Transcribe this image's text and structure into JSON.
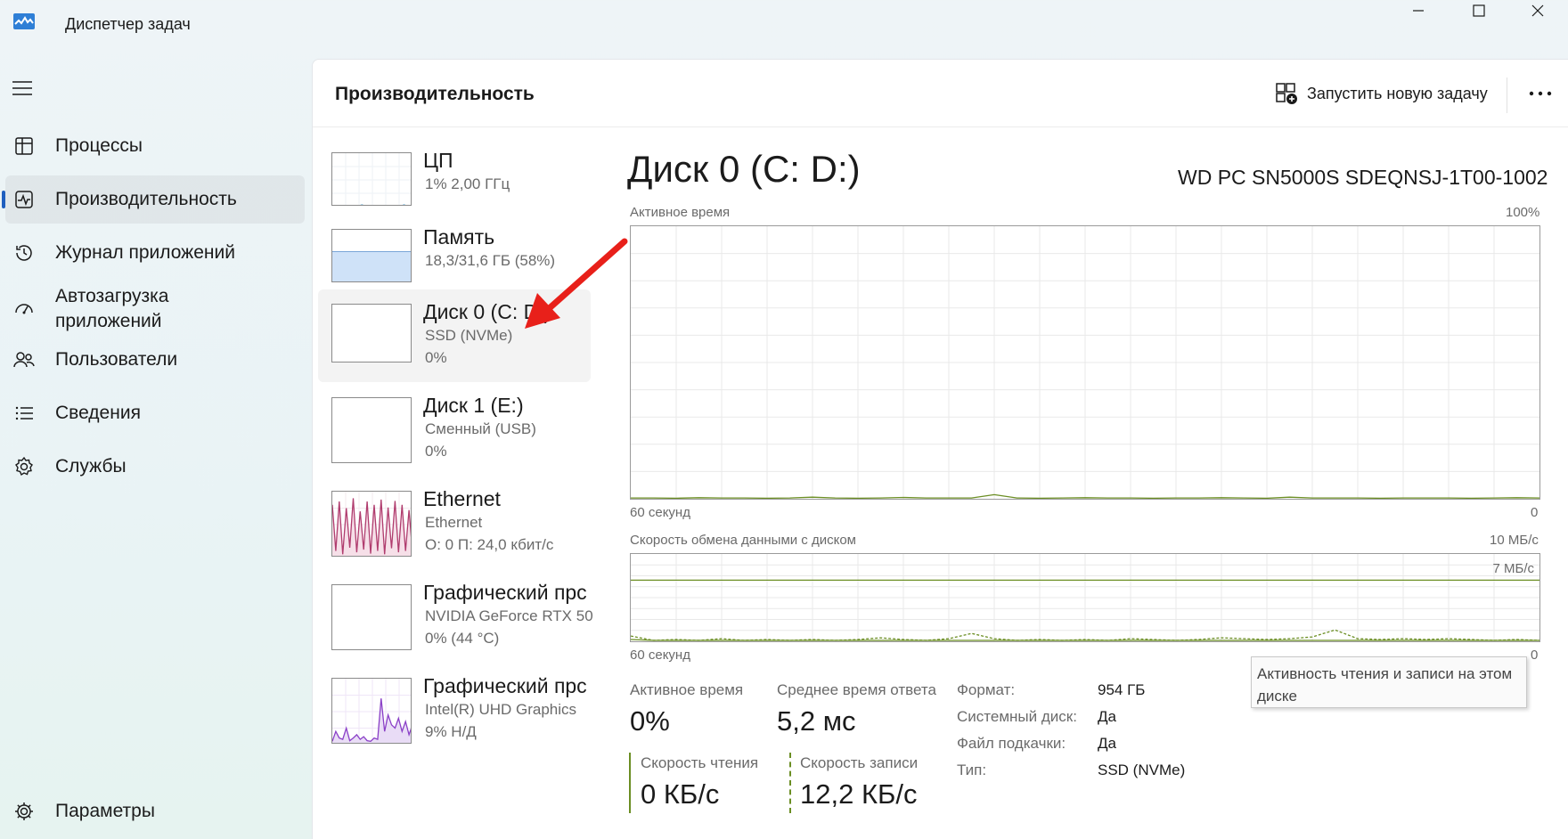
{
  "window": {
    "title": "Диспетчер задач"
  },
  "sidebar": {
    "items": [
      {
        "label": "Процессы",
        "icon": "processes-icon"
      },
      {
        "label": "Производительность",
        "icon": "performance-icon",
        "active": true
      },
      {
        "label": "Журнал приложений",
        "icon": "app-history-icon"
      },
      {
        "label": "Автозагрузка приложений",
        "icon": "startup-apps-icon"
      },
      {
        "label": "Пользователи",
        "icon": "users-icon"
      },
      {
        "label": "Сведения",
        "icon": "details-icon"
      },
      {
        "label": "Службы",
        "icon": "services-icon"
      }
    ],
    "settings_label": "Параметры"
  },
  "header": {
    "title": "Производительность",
    "run_task_label": "Запустить новую задачу"
  },
  "devices": [
    {
      "name": "ЦП",
      "line1": "1%  2,00 ГГц",
      "line2": ""
    },
    {
      "name": "Память",
      "line1": "18,3/31,6 ГБ (58%)",
      "line2": ""
    },
    {
      "name": "Диск 0 (C: D:)",
      "line1": "SSD (NVMe)",
      "line2": "0%"
    },
    {
      "name": "Диск 1 (E:)",
      "line1": "Сменный (USB)",
      "line2": "0%"
    },
    {
      "name": "Ethernet",
      "line1": "Ethernet",
      "line2": "О: 0  П: 24,0 кбит/с"
    },
    {
      "name": "Графический прс",
      "line1": "NVIDIA GeForce RTX 50",
      "line2": "0%  (44 °C)"
    },
    {
      "name": "Графический прс",
      "line1": "Intel(R) UHD Graphics",
      "line2": "9%  Н/Д"
    }
  ],
  "detail": {
    "title": "Диск 0 (C: D:)",
    "model": "WD PC SN5000S SDEQNSJ-1T00-1002",
    "graph1": {
      "label": "Активное время",
      "max_label": "100%",
      "time_label": "60 секунд",
      "min_label": "0",
      "values": [
        0.3,
        0.3,
        0.2,
        0.4,
        0.3,
        0.3,
        0.2,
        0.3,
        0.6,
        0.3,
        0.2,
        0.3,
        0.5,
        0.3,
        0.3,
        0.3,
        1.5,
        0.3,
        0.2,
        0.3,
        0.4,
        0.3,
        0.3,
        0.2,
        0.3,
        0.3,
        0.4,
        0.3,
        0.2,
        0.6,
        0.3,
        0.3,
        0.3,
        0.2,
        0.3,
        0.3,
        0.3,
        0.2,
        0.3,
        0.4,
        0.3
      ]
    },
    "graph2": {
      "label": "Скорость обмена данными с диском",
      "max_label": "10 МБ/с",
      "ref_label": "7 МБ/с",
      "ref_value": 7,
      "max_value": 10,
      "time_label": "60 секунд",
      "min_label": "0",
      "read_values": [
        0.2,
        0.1,
        0.1,
        0.1,
        0.1,
        0.1,
        0.1,
        0.1,
        0.1,
        0.1,
        0.1,
        0.1,
        0.1,
        0.1,
        0.1,
        0.1,
        0.1,
        0.1,
        0.1,
        0.1,
        0.1,
        0.1,
        0.1,
        0.1,
        0.1,
        0.1,
        0.1,
        0.1,
        0.1,
        0.1,
        0.1,
        0.1,
        0.1,
        0.1,
        0.1,
        0.1,
        0.1,
        0.1,
        0.1,
        0.1,
        0.1
      ],
      "write_values": [
        0.6,
        0.1,
        0.2,
        0.1,
        0.3,
        0.1,
        0.2,
        0.1,
        0.2,
        0.1,
        0.2,
        0.4,
        0.2,
        0.1,
        0.3,
        0.9,
        0.3,
        0.1,
        0.2,
        0.1,
        0.2,
        0.1,
        0.3,
        0.2,
        0.1,
        0.2,
        0.4,
        0.3,
        0.2,
        0.3,
        0.5,
        1.3,
        0.3,
        0.2,
        0.3,
        0.2,
        0.3,
        0.2,
        0.1,
        0.2,
        0.1
      ]
    },
    "stats": {
      "active_time_label": "Активное время",
      "active_time_value": "0%",
      "avg_response_label": "Среднее время ответа",
      "avg_response_value": "5,2 мс",
      "read_speed_label": "Скорость чтения",
      "read_speed_value": "0 КБ/с",
      "write_speed_label": "Скорость записи",
      "write_speed_value": "12,2 КБ/с"
    },
    "props": {
      "format_label": "Формат:",
      "format_value": "954 ГБ",
      "system_label": "Системный диск:",
      "system_value": "Да",
      "pagefile_label": "Файл подкачки:",
      "pagefile_value": "Да",
      "type_label": "Тип:",
      "type_value": "SSD (NVMe)"
    },
    "tooltip": "Активность чтения и записи на этом диске"
  },
  "thumbnails": {
    "cpu_values": [
      2,
      1,
      2,
      1,
      1,
      2,
      1,
      3,
      1,
      2,
      1,
      1,
      2,
      1,
      2,
      1,
      1,
      3,
      1,
      2
    ],
    "memory_percent": 58,
    "ethernet_values": [
      80,
      10,
      85,
      5,
      75,
      15,
      90,
      8,
      70,
      12,
      85,
      6,
      80,
      10,
      88,
      5,
      76,
      14,
      86,
      8,
      80,
      10,
      72,
      9
    ],
    "intel_gpu_values": [
      5,
      20,
      10,
      8,
      25,
      6,
      10,
      15,
      8,
      12,
      6,
      5,
      10,
      8,
      70,
      20,
      45,
      30,
      25,
      40,
      20,
      35,
      15,
      30
    ]
  },
  "colors": {
    "disk_line": "#6b8e23",
    "cpu_line": "#1e88c8",
    "memory_fill": "#cfe2f8",
    "ethernet_line": "#b03c6e",
    "gpu_line": "#8a3fc7",
    "arrow": "#e8201a"
  }
}
